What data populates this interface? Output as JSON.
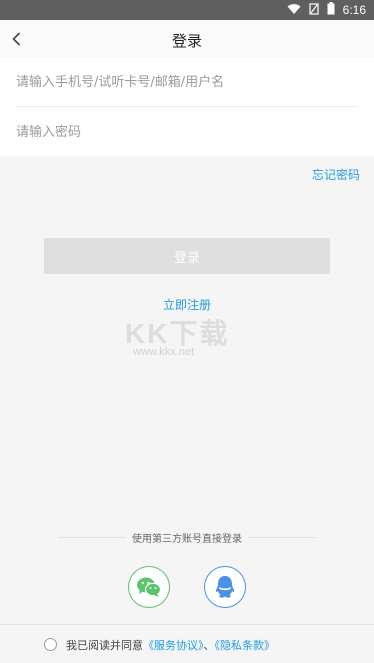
{
  "status_bar": {
    "time": "6:16",
    "icons": [
      "wifi-icon",
      "sim-icon",
      "battery-icon"
    ]
  },
  "header": {
    "title": "登录",
    "back_icon": "chevron-left-icon"
  },
  "form": {
    "account_placeholder": "请输入手机号/试听卡号/邮箱/用户名",
    "password_placeholder": "请输入密码",
    "forgot_label": "忘记密码"
  },
  "actions": {
    "login_label": "登录",
    "register_label": "立即注册"
  },
  "watermark": {
    "text": "KK下载",
    "url": "www.kkx.net"
  },
  "third_party": {
    "label": "使用第三方账号直接登录",
    "wechat_icon": "wechat-icon",
    "qq_icon": "qq-icon"
  },
  "footer": {
    "prefix": "我已阅读并同意",
    "service": "《服务协议》",
    "separator": "、",
    "privacy": "《隐私条款》"
  },
  "colors": {
    "accent": "#1f9be4",
    "wechat": "#5ac46b",
    "qq": "#4b91e6",
    "button_disabled": "#dedede"
  }
}
